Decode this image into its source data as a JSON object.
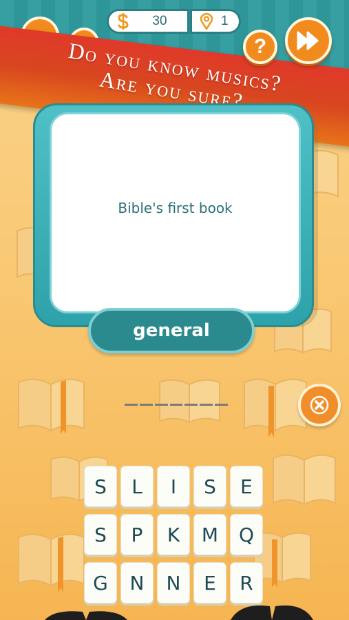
{
  "hud": {
    "coins": "30",
    "hints": "1",
    "help_label": "?"
  },
  "banner": {
    "line1": "Do you know musics?",
    "line2": "Are you sure?"
  },
  "question": {
    "clue": "Bible's first book",
    "category": "general"
  },
  "answer": {
    "slot_count": 7
  },
  "letters": [
    "S",
    "L",
    "I",
    "S",
    "E",
    "S",
    "P",
    "K",
    "M",
    "Q",
    "G",
    "N",
    "N",
    "E",
    "R"
  ],
  "colors": {
    "teal": "#2f9b9e",
    "orange": "#f18b1e",
    "banner_red": "#e0392a",
    "card_border": "#2ea2aa"
  },
  "icons": [
    "coin-dollar-icon",
    "map-pin-icon",
    "question-icon",
    "fast-forward-icon",
    "clear-x-icon"
  ]
}
